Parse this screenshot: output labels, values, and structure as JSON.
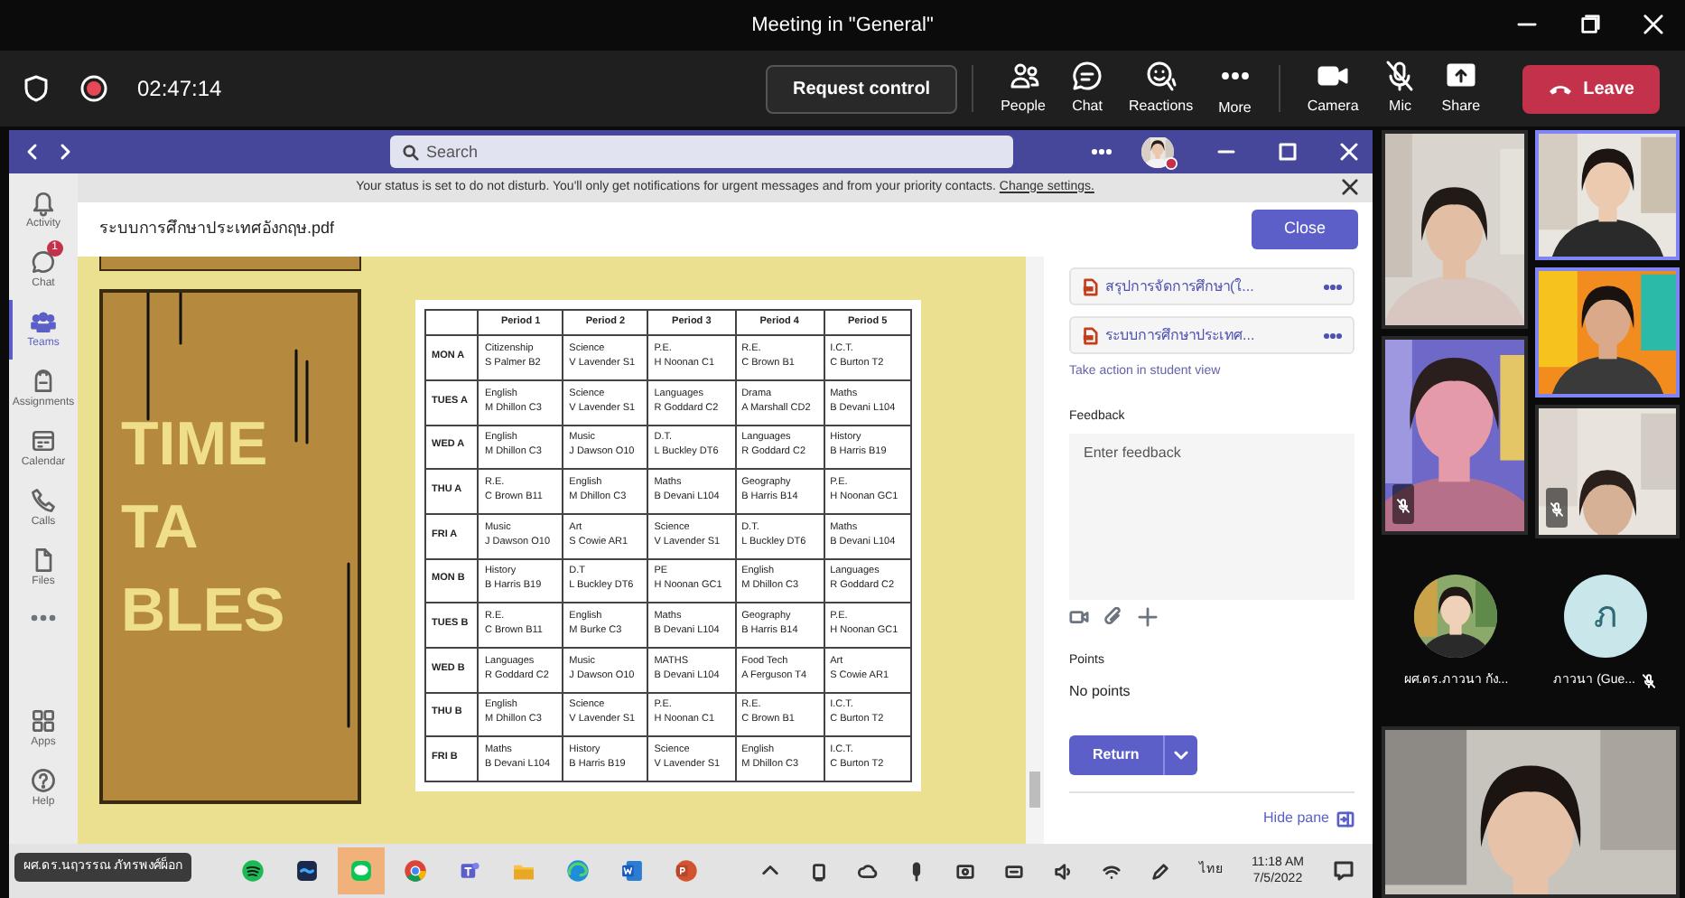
{
  "window": {
    "title": "Meeting in \"General\""
  },
  "meeting_bar": {
    "recording": true,
    "timer": "02:47:14",
    "request_control": "Request control",
    "actions": [
      {
        "label": "People"
      },
      {
        "label": "Chat"
      },
      {
        "label": "Reactions"
      },
      {
        "label": "More"
      }
    ],
    "devices": [
      {
        "label": "Camera"
      },
      {
        "label": "Mic"
      },
      {
        "label": "Share"
      }
    ],
    "leave": "Leave"
  },
  "teams": {
    "search": {
      "placeholder": "Search"
    },
    "rail": [
      {
        "label": "Activity",
        "selected": false
      },
      {
        "label": "Chat",
        "selected": false,
        "badge": "1"
      },
      {
        "label": "Teams",
        "selected": true
      },
      {
        "label": "Assignments",
        "selected": false
      },
      {
        "label": "Calendar",
        "selected": false
      },
      {
        "label": "Calls",
        "selected": false
      },
      {
        "label": "Files",
        "selected": false
      }
    ],
    "rail_bottom": [
      {
        "label": "Apps",
        "selected": false
      },
      {
        "label": "Help",
        "selected": false
      }
    ],
    "notice": {
      "text": "Your status is set to do not disturb. You'll only get notifications for urgent messages and from your priority contacts.",
      "link": "Change settings."
    },
    "document": {
      "filename": "ระบบการศึกษาประเทศอังกฤษ.pdf",
      "close": "Close",
      "poster_text": "TIME\nTA\nBLES",
      "timetable": {
        "columns": [
          "Period 1",
          "Period 2",
          "Period 3",
          "Period 4",
          "Period 5"
        ],
        "rows": [
          {
            "day": "MON A",
            "cells": [
              "Citizenship\nS Palmer B2",
              "Science\nV Lavender S1",
              "P.E.\nH Noonan C1",
              "R.E.\nC Brown B1",
              "I.C.T.\nC Burton T2"
            ]
          },
          {
            "day": "TUES A",
            "cells": [
              "English\nM Dhillon C3",
              "Science\nV Lavender S1",
              "Languages\nR Goddard C2",
              "Drama\nA Marshall CD2",
              "Maths\nB Devani L104"
            ]
          },
          {
            "day": "WED A",
            "cells": [
              "English\nM Dhillon C3",
              "Music\nJ Dawson O10",
              "D.T.\nL Buckley DT6",
              "Languages\nR Goddard C2",
              "History\nB Harris B19"
            ]
          },
          {
            "day": "THU A",
            "cells": [
              "R.E.\nC Brown B11",
              "English\nM Dhillon C3",
              "Maths\nB Devani L104",
              "Geography\nB Harris B14",
              "P.E.\nH Noonan GC1"
            ]
          },
          {
            "day": "FRI A",
            "cells": [
              "Music\nJ Dawson O10",
              "Art\nS Cowie AR1",
              "Science\nV Lavender S1",
              "D.T.\nL Buckley DT6",
              "Maths\nB Devani L104"
            ]
          },
          {
            "day": "MON B",
            "cells": [
              "History\nB Harris B19",
              "D.T\nL Buckley DT6",
              "PE\nH Noonan GC1",
              "English\nM Dhillon C3",
              "Languages\nR Goddard C2"
            ]
          },
          {
            "day": "TUES B",
            "cells": [
              "R.E.\nC Brown B11",
              "English\nM Burke C3",
              "Maths\nB Devani L104",
              "Geography\nB Harris B14",
              "P.E.\nH Noonan GC1"
            ]
          },
          {
            "day": "WED B",
            "cells": [
              "Languages\nR Goddard C2",
              "Music\nJ Dawson O10",
              "MATHS\nB Devani L104",
              "Food Tech\nA Ferguson T4",
              "Art\nS Cowie AR1"
            ]
          },
          {
            "day": "THU B",
            "cells": [
              "English\nM Dhillon C3",
              "Science\nV Lavender S1",
              "P.E.\nH Noonan C1",
              "R.E.\nC Brown B1",
              "I.C.T.\nC Burton T2"
            ]
          },
          {
            "day": "FRI B",
            "cells": [
              "Maths\nB Devani L104",
              "History\nB Harris B19",
              "Science\nV Lavender S1",
              "English\nM Dhillon C3",
              "I.C.T.\nC Burton T2"
            ]
          }
        ]
      }
    },
    "pane": {
      "attachments": [
        {
          "name": "สรุปการจัดการศึกษา(ใ..."
        },
        {
          "name": "ระบบการศึกษาประเทศ..."
        }
      ],
      "student_view_link": "Take action in student view",
      "feedback": {
        "label": "Feedback",
        "placeholder": "Enter feedback"
      },
      "points": {
        "label": "Points",
        "value": "No points"
      },
      "return": "Return",
      "hide_pane": "Hide pane"
    }
  },
  "presenter": {
    "name": "ผศ.ดร.นฤวรรณ ภัทรพงศ์ผ็อก"
  },
  "taskbar": {
    "apps": [
      {
        "selected": false
      },
      {
        "selected": false
      },
      {
        "selected": true
      },
      {
        "selected": false
      },
      {
        "selected": false
      },
      {
        "selected": false
      },
      {
        "selected": false
      },
      {
        "selected": false
      },
      {
        "selected": false
      }
    ],
    "language": "ไทย",
    "time": "11:18 AM",
    "date": "7/5/2022"
  },
  "videos": {
    "tiles": [
      {
        "kind": "picture",
        "speaking": false,
        "muted": false
      },
      {
        "kind": "picture",
        "speaking": true,
        "muted": false
      },
      {
        "kind": "picture",
        "speaking": true,
        "muted": false
      },
      {
        "kind": "picture",
        "speaking": false,
        "muted": true
      },
      {
        "kind": "picture",
        "speaking": false,
        "muted": true
      },
      {
        "kind": "picture",
        "speaking": false,
        "muted": false
      }
    ],
    "avatars": [
      {
        "name": "ผศ.ดร.ภาวนา กัง...",
        "muted": false
      },
      {
        "kind": "initial",
        "initial": "ภ",
        "name": "ภาวนา (Gue...",
        "muted": true
      }
    ]
  }
}
